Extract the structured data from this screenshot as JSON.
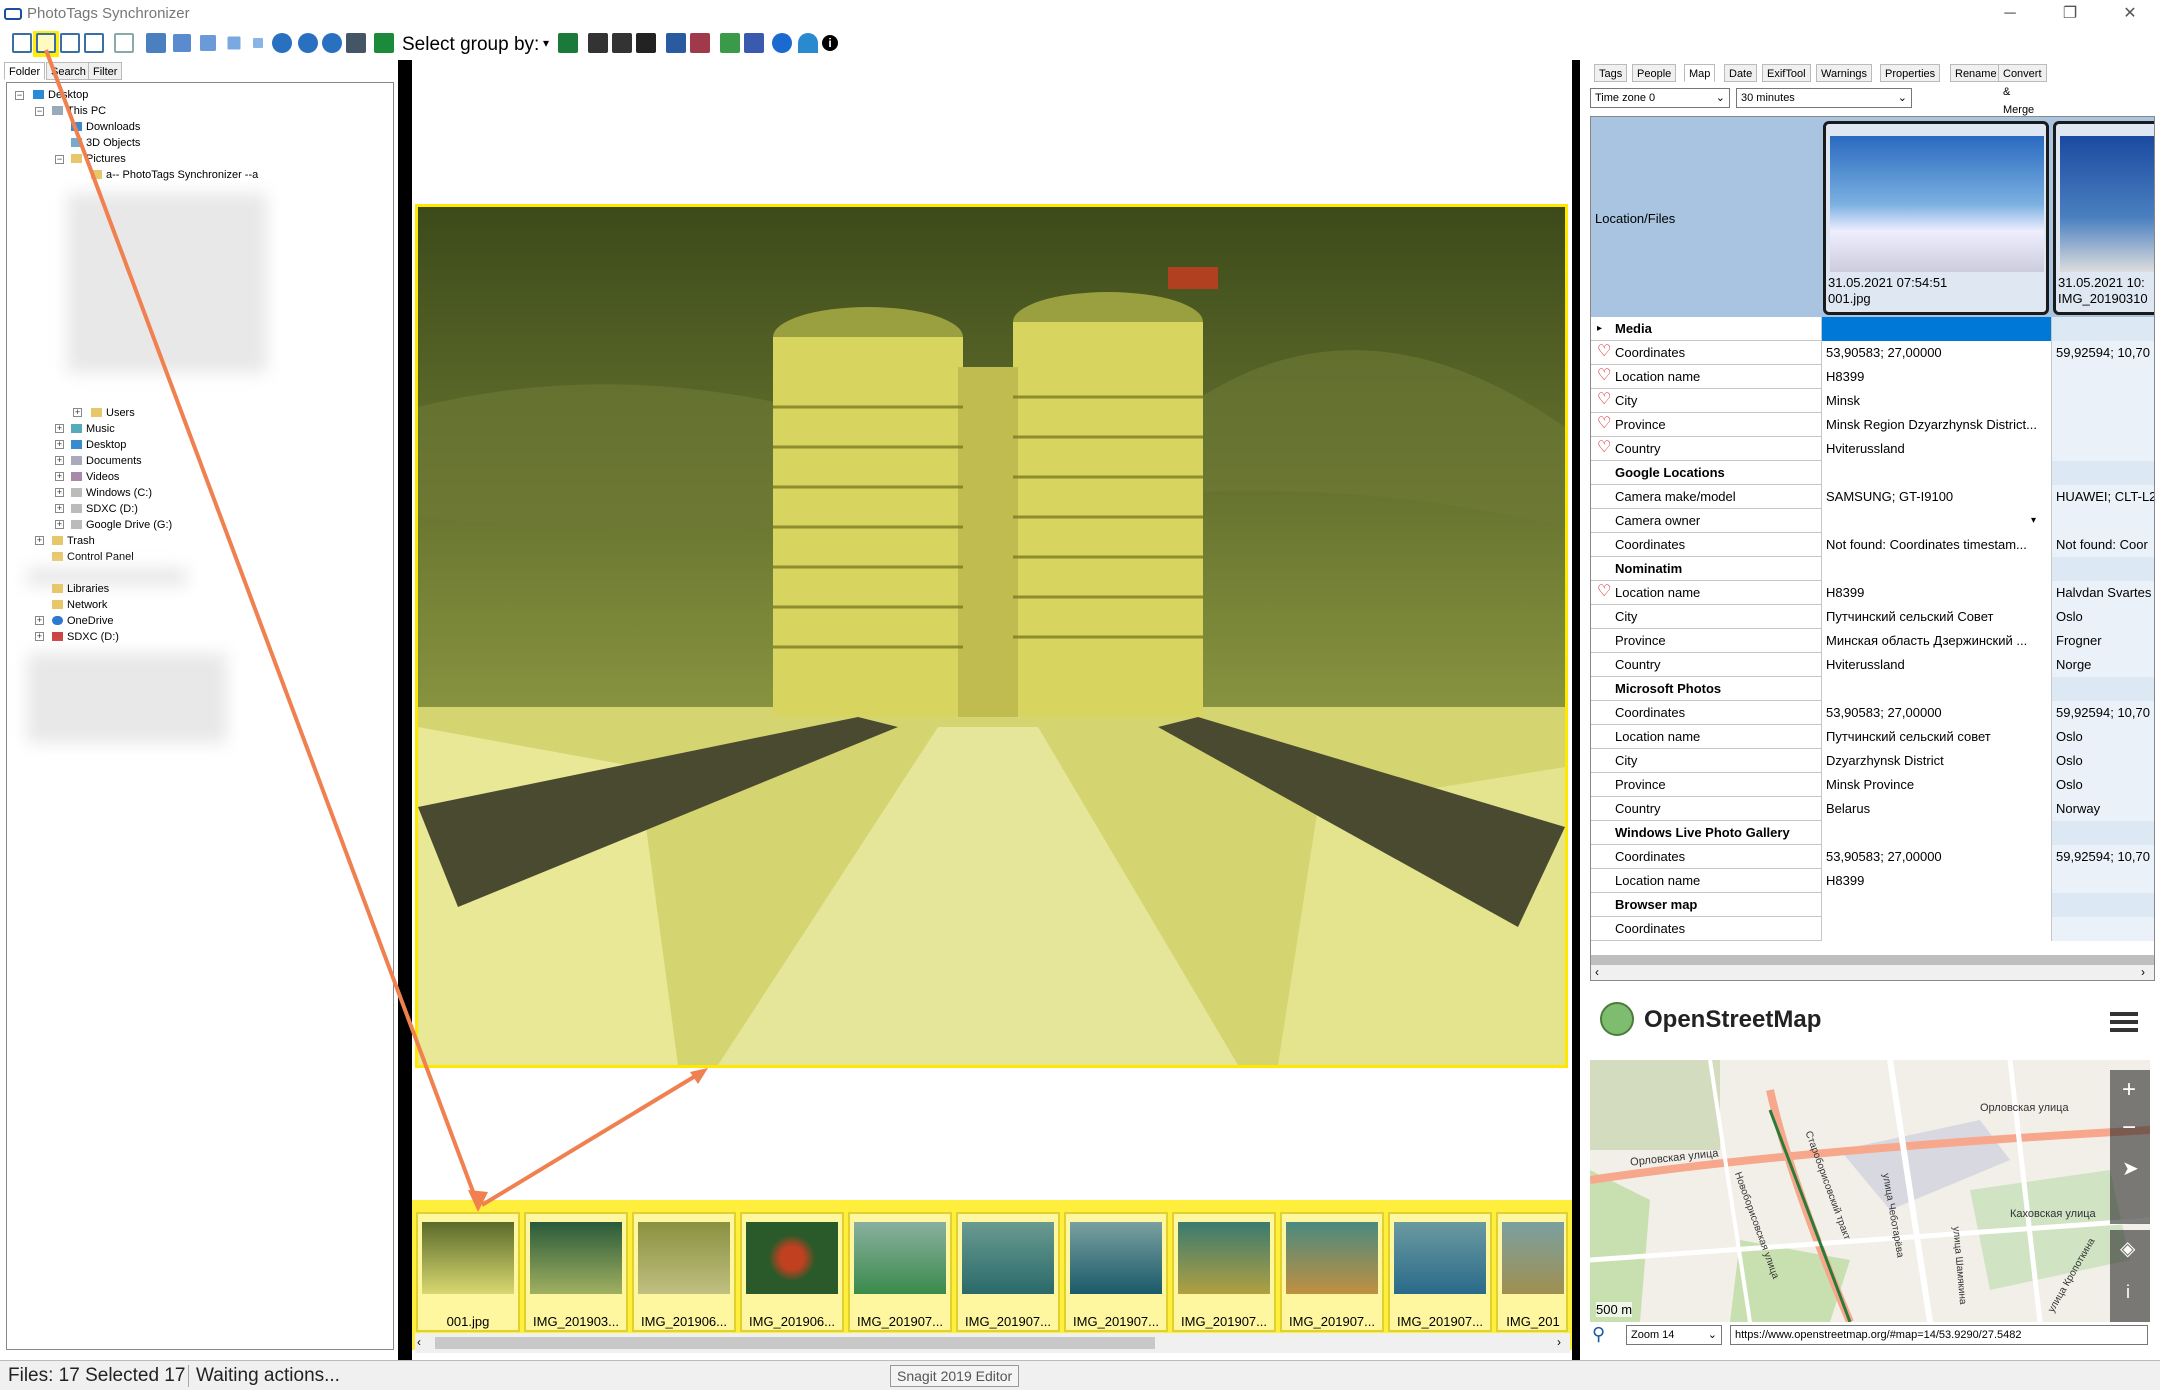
{
  "window": {
    "title": "PhotoTags Synchronizer",
    "minimize": "─",
    "maximize": "❐",
    "close": "✕"
  },
  "toolbar": {
    "select_group_label": "Select group by:"
  },
  "left_panel": {
    "tabs": [
      "Folder",
      "Search",
      "Filter"
    ],
    "tree": [
      {
        "label": "Desktop",
        "depth": 0
      },
      {
        "label": "This PC",
        "depth": 1
      },
      {
        "label": "Downloads",
        "depth": 2
      },
      {
        "label": "3D Objects",
        "depth": 2
      },
      {
        "label": "Pictures",
        "depth": 2
      },
      {
        "label": "a-- PhotoTags Synchronizer --a",
        "depth": 3
      },
      {
        "label": "Users",
        "depth": 3
      },
      {
        "label": "Music",
        "depth": 2
      },
      {
        "label": "Desktop",
        "depth": 2
      },
      {
        "label": "Documents",
        "depth": 2
      },
      {
        "label": "Videos",
        "depth": 2
      },
      {
        "label": "Windows (C:)",
        "depth": 2
      },
      {
        "label": "SDXC (D:)",
        "depth": 2
      },
      {
        "label": "Google Drive (G:)",
        "depth": 2
      },
      {
        "label": "Trash",
        "depth": 1
      },
      {
        "label": "Control Panel",
        "depth": 1
      },
      {
        "label": "Libraries",
        "depth": 1
      },
      {
        "label": "Network",
        "depth": 1
      },
      {
        "label": "OneDrive",
        "depth": 1
      },
      {
        "label": "SDXC (D:)",
        "depth": 1
      }
    ]
  },
  "filmstrip": {
    "thumbnails": [
      "001.jpg",
      "IMG_201903...",
      "IMG_201906...",
      "IMG_201906...",
      "IMG_201907...",
      "IMG_201907...",
      "IMG_201907...",
      "IMG_201907...",
      "IMG_201907...",
      "IMG_201907...",
      "IMG_201"
    ]
  },
  "right_panel": {
    "tabs": [
      "Tags",
      "People",
      "Map",
      "Date",
      "ExifTool",
      "Warnings",
      "Properties",
      "Rename",
      "Convert & Merge"
    ],
    "timezone": "Time zone 0",
    "interval": "30 minutes",
    "grid": {
      "header_label": "Location/Files",
      "file1": {
        "date": "31.05.2021 07:54:51",
        "name": "001.jpg"
      },
      "file2": {
        "date": "31.05.2021 10:",
        "name": "IMG_20190310"
      },
      "rows": [
        {
          "label": "Media",
          "v1": "",
          "v2": "",
          "bold": true,
          "heart": false,
          "expander": true
        },
        {
          "label": "Coordinates",
          "v1": "53,90583; 27,00000",
          "v2": "59,92594; 10,70",
          "bold": false,
          "heart": true
        },
        {
          "label": "Location name",
          "v1": "H8399",
          "v2": "",
          "bold": false,
          "heart": true
        },
        {
          "label": "City",
          "v1": "Minsk",
          "v2": "",
          "bold": false,
          "heart": true
        },
        {
          "label": "Province",
          "v1": "Minsk Region Dzyarzhynsk District...",
          "v2": "",
          "bold": false,
          "heart": true
        },
        {
          "label": "Country",
          "v1": "Hviterussland",
          "v2": "",
          "bold": false,
          "heart": true
        },
        {
          "label": "Google Locations",
          "v1": "",
          "v2": "",
          "bold": true,
          "heart": false
        },
        {
          "label": "Camera make/model",
          "v1": "SAMSUNG; GT-I9100",
          "v2": "HUAWEI; CLT-L2",
          "bold": false,
          "heart": false
        },
        {
          "label": "Camera owner",
          "v1": "",
          "v2": "",
          "bold": false,
          "heart": false
        },
        {
          "label": "Coordinates",
          "v1": "Not found: Coordinates timestam...",
          "v2": "Not found: Coor",
          "bold": false,
          "heart": false
        },
        {
          "label": "Nominatim",
          "v1": "",
          "v2": "",
          "bold": true,
          "heart": false
        },
        {
          "label": "Location name",
          "v1": "H8399",
          "v2": "Halvdan Svartes",
          "bold": false,
          "heart": true
        },
        {
          "label": "City",
          "v1": "Путчинский сельский Совет",
          "v2": "Oslo",
          "bold": false,
          "heart": false
        },
        {
          "label": "Province",
          "v1": "Минская область Дзержинский ...",
          "v2": "Frogner",
          "bold": false,
          "heart": false
        },
        {
          "label": "Country",
          "v1": "Hviterussland",
          "v2": "Norge",
          "bold": false,
          "heart": false
        },
        {
          "label": "Microsoft Photos",
          "v1": "",
          "v2": "",
          "bold": true,
          "heart": false
        },
        {
          "label": "Coordinates",
          "v1": "53,90583; 27,00000",
          "v2": "59,92594; 10,70",
          "bold": false,
          "heart": false
        },
        {
          "label": "Location name",
          "v1": "Путчинский сельский совет",
          "v2": "Oslo",
          "bold": false,
          "heart": false
        },
        {
          "label": "City",
          "v1": "Dzyarzhynsk District",
          "v2": "Oslo",
          "bold": false,
          "heart": false
        },
        {
          "label": "Province",
          "v1": "Minsk Province",
          "v2": "Oslo",
          "bold": false,
          "heart": false
        },
        {
          "label": "Country",
          "v1": "Belarus",
          "v2": "Norway",
          "bold": false,
          "heart": false
        },
        {
          "label": "Windows Live Photo Gallery",
          "v1": "",
          "v2": "",
          "bold": true,
          "heart": false
        },
        {
          "label": "Coordinates",
          "v1": "53,90583; 27,00000",
          "v2": "59,92594; 10,70",
          "bold": false,
          "heart": false
        },
        {
          "label": "Location name",
          "v1": "H8399",
          "v2": "",
          "bold": false,
          "heart": false
        },
        {
          "label": "Browser map",
          "v1": "",
          "v2": "",
          "bold": true,
          "heart": false
        },
        {
          "label": "Coordinates",
          "v1": "",
          "v2": "",
          "bold": false,
          "heart": false
        }
      ]
    }
  },
  "map": {
    "title": "OpenStreetMap",
    "scale": "500 m",
    "zoom": "Zoom 14",
    "url": "https://www.openstreetmap.org/#map=14/53.9290/27.5482",
    "streets": [
      "Орловская улица",
      "Орловская улица",
      "Староборисовский тракт",
      "улица Чеботарёва",
      "Каховская улица",
      "Новоборисовская улица",
      "улица Шамякина",
      "улица Кропоткина"
    ]
  },
  "status": {
    "files": "Files: 17 Selected 17",
    "message": "Waiting actions...",
    "tooltip": "Snagit 2019 Editor"
  },
  "colors": {
    "highlight": "#ffee00",
    "arrow": "#f08050",
    "grid_header": "#a8c4e0",
    "selected_cell": "#0078d7"
  }
}
